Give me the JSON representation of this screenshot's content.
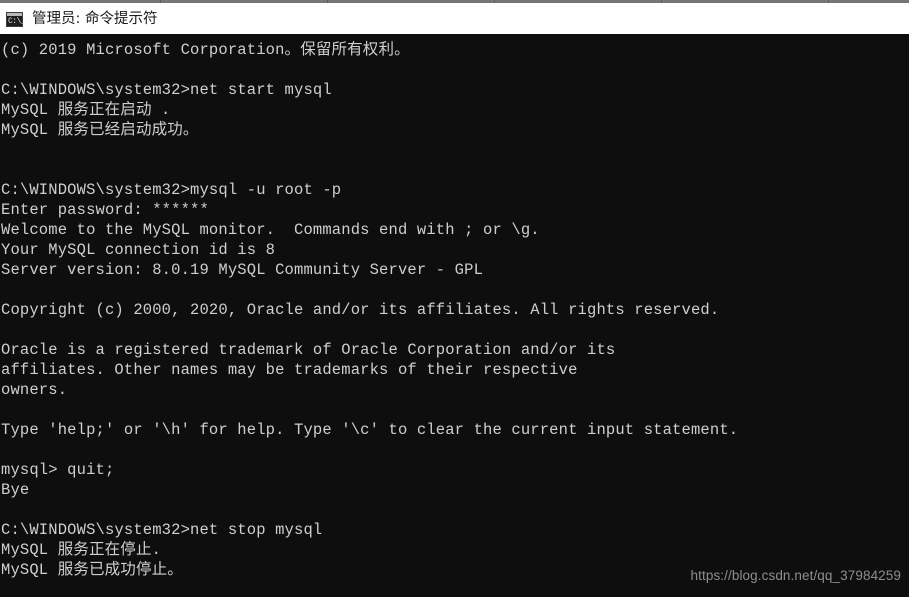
{
  "window": {
    "title": "管理员: 命令提示符",
    "icon": "console-icon",
    "icon_glyph": "C:\\_",
    "background": "#0e0e0e",
    "text_color": "#cfcfcf",
    "titlebar_background": "#ffffff",
    "titlebar_text_color": "#1b1b1b"
  },
  "console": {
    "lines": [
      "(c) 2019 Microsoft Corporation。保留所有权利。",
      "",
      "C:\\WINDOWS\\system32>net start mysql",
      "MySQL 服务正在启动 .",
      "MySQL 服务已经启动成功。",
      "",
      "",
      "C:\\WINDOWS\\system32>mysql -u root -p",
      "Enter password: ******",
      "Welcome to the MySQL monitor.  Commands end with ; or \\g.",
      "Your MySQL connection id is 8",
      "Server version: 8.0.19 MySQL Community Server - GPL",
      "",
      "Copyright (c) 2000, 2020, Oracle and/or its affiliates. All rights reserved.",
      "",
      "Oracle is a registered trademark of Oracle Corporation and/or its",
      "affiliates. Other names may be trademarks of their respective",
      "owners.",
      "",
      "Type 'help;' or '\\h' for help. Type '\\c' to clear the current input statement.",
      "",
      "mysql> quit;",
      "Bye",
      "",
      "C:\\WINDOWS\\system32>net stop mysql",
      "MySQL 服务正在停止.",
      "MySQL 服务已成功停止。"
    ]
  },
  "watermark": {
    "text": "https://blog.csdn.net/qq_37984259"
  }
}
